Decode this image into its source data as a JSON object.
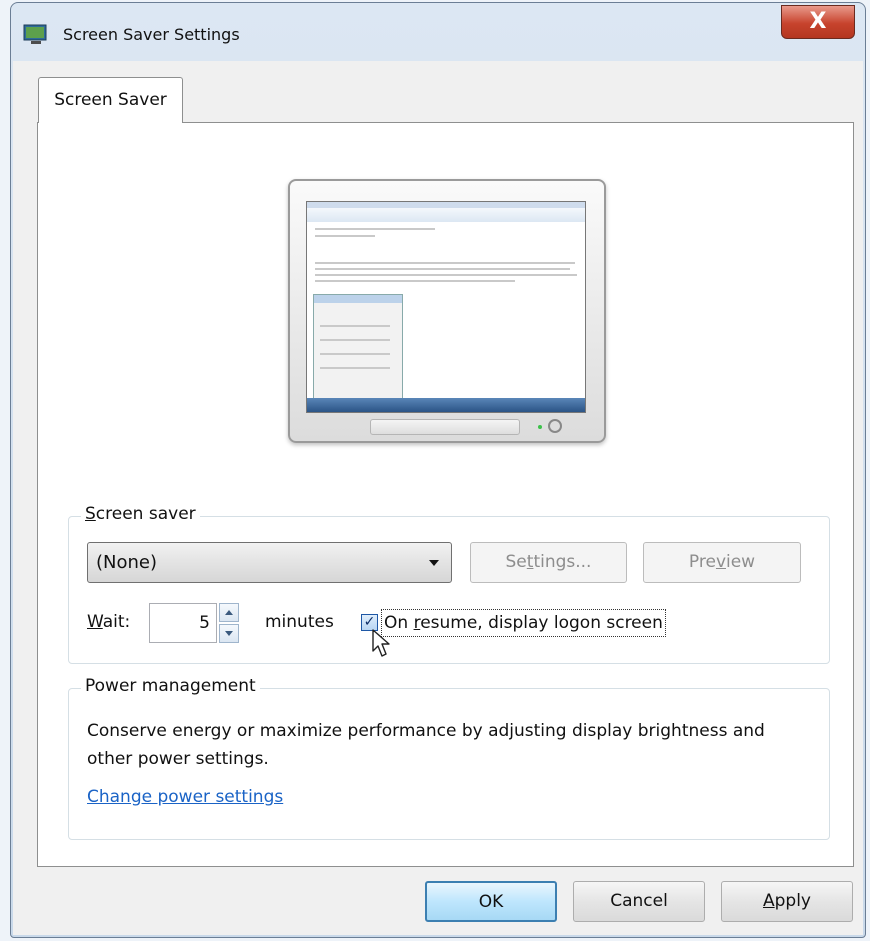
{
  "window": {
    "title": "Screen Saver Settings",
    "close_label": "X"
  },
  "tabs": [
    {
      "label": "Screen Saver",
      "selected": true
    }
  ],
  "screen_saver": {
    "group_label_prefix": "S",
    "group_label_rest": "creen saver",
    "selected": "(None)",
    "settings_pre": "Se",
    "settings_mn": "t",
    "settings_post": "tings...",
    "preview_pre": "Pre",
    "preview_mn": "v",
    "preview_post": "iew",
    "wait_mn": "W",
    "wait_rest": "ait:",
    "wait_value": "5",
    "minutes_label": "minutes",
    "resume_checked": true,
    "check_mark": "✓",
    "resume_pre": "On ",
    "resume_mn": "r",
    "resume_post": "esume, display logon screen"
  },
  "power_management": {
    "group_label": "Power management",
    "description": "Conserve energy or maximize performance by adjusting display brightness and other power settings.",
    "link_text": "Change power settings"
  },
  "footer": {
    "ok": "OK",
    "cancel": "Cancel",
    "apply_mn": "A",
    "apply_rest": "pply"
  },
  "colors": {
    "accent": "#1a63c6",
    "close": "#c7432d"
  }
}
